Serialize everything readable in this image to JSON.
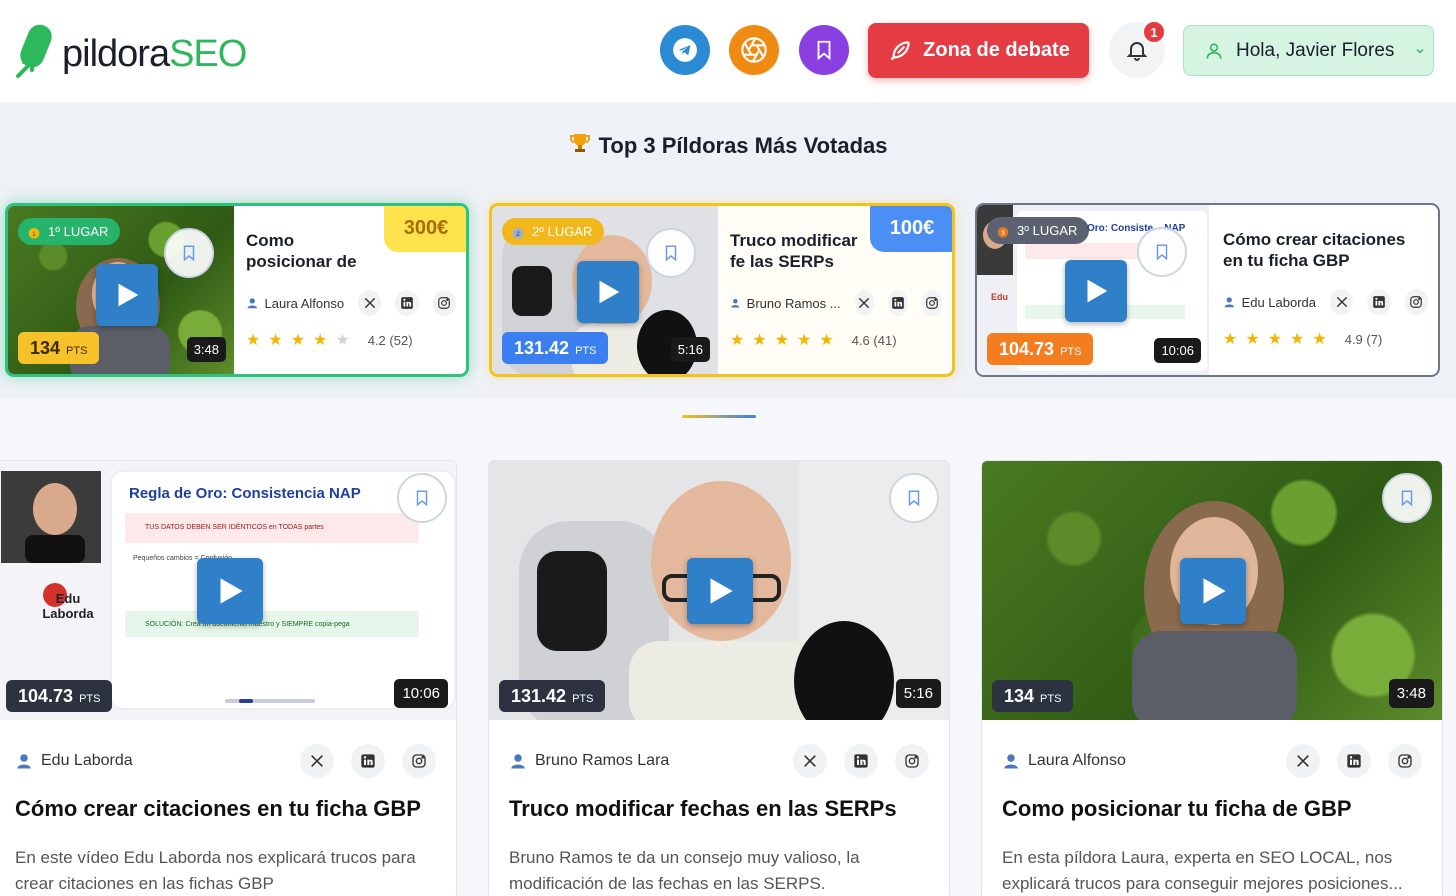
{
  "header": {
    "logo_part1": "pildora",
    "logo_part2": "SEO",
    "debate_label": "Zona de debate",
    "notifications_count": "1",
    "user_greeting": "Hola, Javier Flores"
  },
  "top": {
    "title": "Top 3 Píldoras Más Votadas",
    "cards": [
      {
        "place": "1º LUGAR",
        "prize": "300€",
        "points": "134",
        "pts_unit": "PTS",
        "duration": "3:48",
        "title": "Como posicionar de GBP",
        "author": "Laura Alfonso",
        "rating": "4.2 (52)",
        "stars": 4
      },
      {
        "place": "2º LUGAR",
        "prize": "100€",
        "points": "131.42",
        "pts_unit": "PTS",
        "duration": "5:16",
        "title": "Truco modificar fe las SERPs",
        "author": "Bruno Ramos ...",
        "rating": "4.6 (41)",
        "stars": 5
      },
      {
        "place": "3º LUGAR",
        "points": "104.73",
        "pts_unit": "PTS",
        "duration": "10:06",
        "title": "Cómo crear citaciones en tu ficha GBP",
        "author": "Edu Laborda",
        "rating": "4.9 (7)",
        "stars": 5,
        "slide_title": "Oro: Consiste... NAP"
      }
    ]
  },
  "cards": [
    {
      "author": "Edu Laborda",
      "title": "Cómo crear citaciones en tu ficha GBP",
      "desc": "En este vídeo Edu Laborda nos explicará trucos para crear citaciones en las fichas GBP",
      "points": "104.73",
      "pts_unit": "PTS",
      "duration": "10:06",
      "slide_title": "Regla de Oro: Consistencia NAP",
      "slide_line1": "TUS DATOS DEBEN SER IDÉNTICOS en TODAS partes",
      "slide_line2": "Pequeños cambios = Confusión",
      "slide_line3": "SOLUCIÓN: Crea un documento maestro y SIEMPRE copia-pega",
      "logo_text": "Edu Laborda"
    },
    {
      "author": "Bruno Ramos Lara",
      "title": "Truco modificar fechas en las SERPs",
      "desc": "Bruno Ramos te da un consejo muy valioso, la modificación de las fechas en las SERPS.",
      "points": "131.42",
      "pts_unit": "PTS",
      "duration": "5:16"
    },
    {
      "author": "Laura Alfonso",
      "title": "Como posicionar tu ficha de GBP",
      "desc": "En esta píldora Laura, experta en SEO LOCAL, nos explicará trucos para conseguir mejores posiciones...",
      "points": "134",
      "pts_unit": "PTS",
      "duration": "3:48"
    }
  ]
}
